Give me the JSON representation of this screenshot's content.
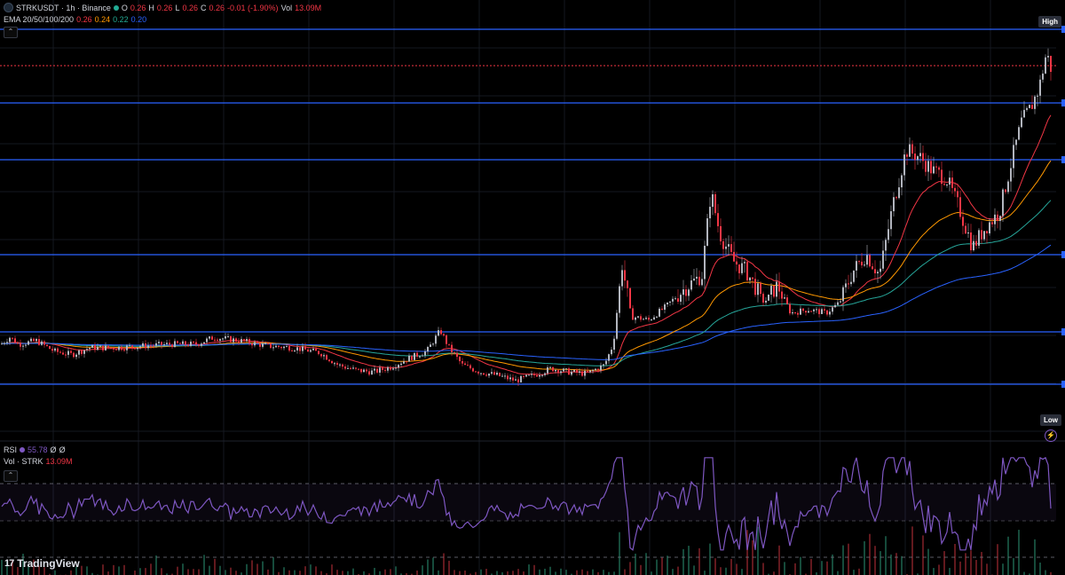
{
  "header": {
    "symbol": "STRKUSDT · 1h · Binance",
    "open_label": "O",
    "open": "0.26",
    "high_label": "H",
    "high": "0.26",
    "low_label": "L",
    "low": "0.26",
    "close_label": "C",
    "close": "0.26",
    "change": "-0.01 (-1.90%)",
    "vol_label": "Vol",
    "vol": "13.09M"
  },
  "ema": {
    "label": "EMA 20/50/100/200",
    "v20": "0.26",
    "v50": "0.24",
    "v100": "0.22",
    "v200": "0.20"
  },
  "rsi": {
    "label": "RSI",
    "value": "55.78",
    "extra1": "Ø",
    "extra2": "Ø"
  },
  "volume": {
    "label": "Vol · STRK",
    "value": "13.09M"
  },
  "badges": {
    "high": "High",
    "low": "Low"
  },
  "brand": {
    "name": "TradingView",
    "mark": "17"
  },
  "colors": {
    "background": "#000000",
    "up": "#b2b5be",
    "down": "#f23645",
    "ema20": "#f23645",
    "ema50": "#ff9800",
    "ema100": "#26a69a",
    "ema200": "#2962ff",
    "horizontal_lines": "#2962ff",
    "rsi": "#7e57c2"
  },
  "chart_data": {
    "type": "candlestick",
    "title": "STRKUSDT · 1h · Binance",
    "price_axis_labels": [],
    "horizontal_levels_relative": [
      0.0,
      0.22,
      0.39,
      0.67,
      0.9,
      1.06
    ],
    "price_path": [
      [
        0,
        0.56
      ],
      [
        10,
        0.58
      ],
      [
        20,
        0.56
      ],
      [
        40,
        0.57
      ],
      [
        60,
        0.54
      ],
      [
        80,
        0.53
      ],
      [
        100,
        0.55
      ],
      [
        130,
        0.55
      ],
      [
        160,
        0.555
      ],
      [
        190,
        0.56
      ],
      [
        220,
        0.56
      ],
      [
        240,
        0.58
      ],
      [
        255,
        0.575
      ],
      [
        270,
        0.57
      ],
      [
        300,
        0.555
      ],
      [
        330,
        0.55
      ],
      [
        360,
        0.535
      ],
      [
        380,
        0.5
      ],
      [
        400,
        0.485
      ],
      [
        420,
        0.48
      ],
      [
        440,
        0.495
      ],
      [
        460,
        0.52
      ],
      [
        480,
        0.54
      ],
      [
        495,
        0.6
      ],
      [
        505,
        0.55
      ],
      [
        520,
        0.5
      ],
      [
        540,
        0.48
      ],
      [
        560,
        0.47
      ],
      [
        580,
        0.455
      ],
      [
        600,
        0.47
      ],
      [
        620,
        0.49
      ],
      [
        640,
        0.48
      ],
      [
        660,
        0.475
      ],
      [
        680,
        0.5
      ],
      [
        690,
        0.56
      ],
      [
        700,
        0.79
      ],
      [
        710,
        0.64
      ],
      [
        730,
        0.63
      ],
      [
        750,
        0.67
      ],
      [
        770,
        0.72
      ],
      [
        790,
        0.76
      ],
      [
        800,
        1.0
      ],
      [
        810,
        0.88
      ],
      [
        825,
        0.8
      ],
      [
        840,
        0.77
      ],
      [
        860,
        0.68
      ],
      [
        875,
        0.73
      ],
      [
        890,
        0.65
      ],
      [
        910,
        0.66
      ],
      [
        930,
        0.65
      ],
      [
        945,
        0.68
      ],
      [
        960,
        0.77
      ],
      [
        975,
        0.82
      ],
      [
        990,
        0.76
      ],
      [
        1005,
        0.96
      ],
      [
        1020,
        1.12
      ],
      [
        1035,
        1.1
      ],
      [
        1050,
        1.06
      ],
      [
        1065,
        1.04
      ],
      [
        1080,
        0.95
      ],
      [
        1095,
        0.84
      ],
      [
        1110,
        0.9
      ],
      [
        1125,
        0.94
      ],
      [
        1140,
        1.1
      ],
      [
        1150,
        1.2
      ],
      [
        1160,
        1.24
      ],
      [
        1170,
        1.3
      ],
      [
        1178,
        1.4
      ],
      [
        1185,
        1.34
      ]
    ],
    "rsi_latest": 55.78,
    "volume_latest": "13.09M"
  }
}
